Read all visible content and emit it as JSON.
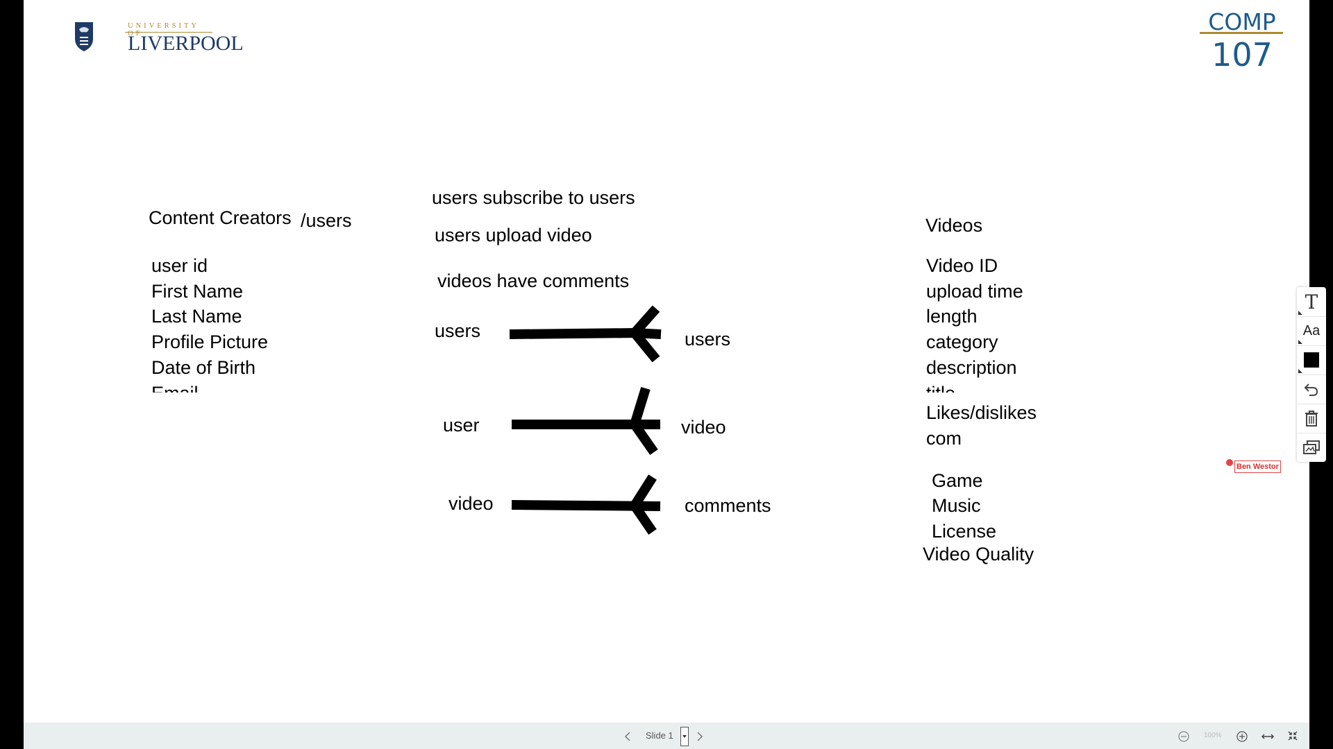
{
  "logos": {
    "university_small": "UNIVERSITY OF",
    "university_big": "LIVERPOOL",
    "course_top": "COMP",
    "course_number": "107"
  },
  "slide": {
    "left_heading": "Content Creators",
    "left_heading_suffix": "/users",
    "left_fields": [
      "user id",
      "First Name",
      "Last Name",
      "Profile Picture",
      "Date of Birth",
      "Email"
    ],
    "relationships": [
      "users subscribe to users",
      "users upload video",
      "videos have comments"
    ],
    "erd_rows": [
      {
        "left": "users",
        "right": "users"
      },
      {
        "left": "user",
        "right": "video"
      },
      {
        "left": "video",
        "right": "comments"
      }
    ],
    "right_heading": "Videos",
    "right_fields": [
      "Video ID",
      "upload time",
      "length",
      "category",
      "description",
      "title"
    ],
    "right_fields_extra": [
      "Likes/dislikes",
      "com"
    ],
    "categories": [
      "Game",
      "Music",
      "License"
    ],
    "video_quality": "Video Quality"
  },
  "toolbar": {
    "items": [
      {
        "icon": "text-icon",
        "label": "T"
      },
      {
        "icon": "font-size-icon",
        "label": "Aa"
      },
      {
        "icon": "color-swatch-icon"
      },
      {
        "icon": "undo-icon"
      },
      {
        "icon": "trash-icon"
      },
      {
        "icon": "screen-share-icon"
      }
    ],
    "swatch_color": "#000000"
  },
  "presenter": {
    "name": "Ben Westor",
    "color": "#e04646"
  },
  "bottom_bar": {
    "slide_label": "Slide 1",
    "zoom": "100%"
  }
}
